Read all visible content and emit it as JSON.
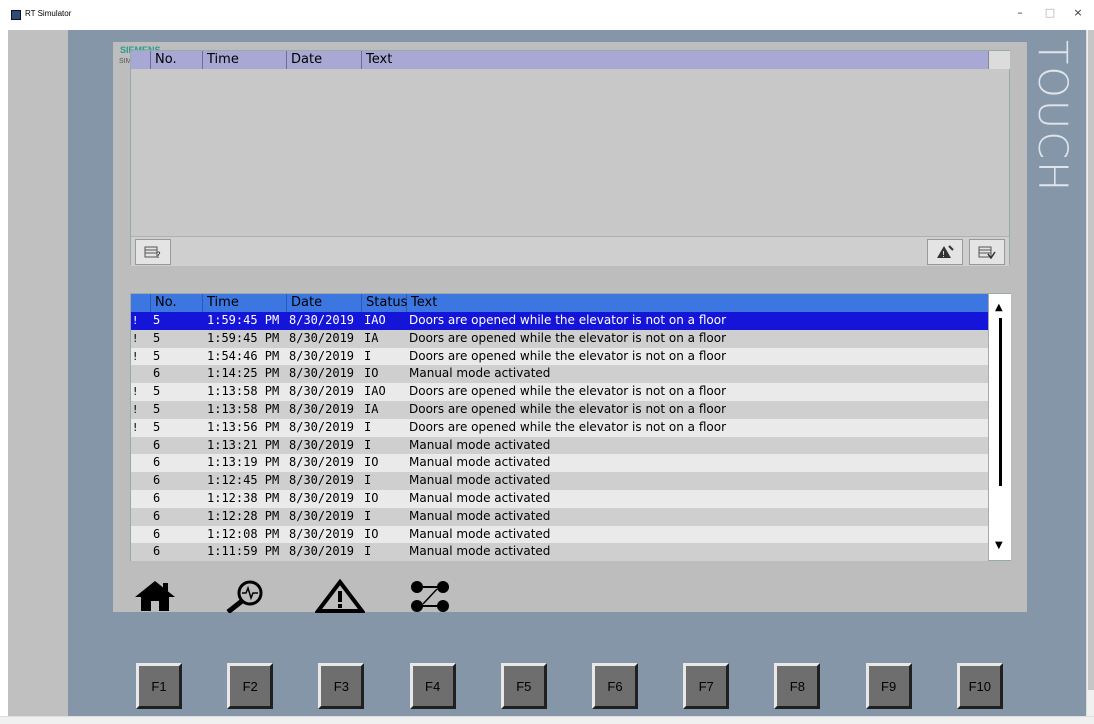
{
  "window": {
    "title": "RT Simulator",
    "minimize": "–",
    "maximize": "□",
    "close": "×"
  },
  "panel": {
    "brand_label": "TOUCH",
    "logo": "SIEMENS",
    "logo_sub": "SIMATIC"
  },
  "alarm_view_top": {
    "columns": [
      "No.",
      "Time",
      "Date",
      "Text"
    ],
    "rows": [],
    "buttons": {
      "info_icon": "info-text-icon",
      "ack_icon": "acknowledge-icon",
      "edit_icon": "edit-icon"
    }
  },
  "alarm_view_bottom": {
    "columns": [
      "No.",
      "Time",
      "Date",
      "Status",
      "Text"
    ],
    "rows": [
      {
        "flag": "!",
        "no": "5",
        "time": "1:59:45 PM",
        "date": "8/30/2019",
        "status": "IAO",
        "text": "Doors are opened while the elevator is not on a floor",
        "selected": true
      },
      {
        "flag": "!",
        "no": "5",
        "time": "1:59:45 PM",
        "date": "8/30/2019",
        "status": "IA",
        "text": "Doors are opened while the elevator is not on a floor"
      },
      {
        "flag": "!",
        "no": "5",
        "time": "1:54:46 PM",
        "date": "8/30/2019",
        "status": "I",
        "text": "Doors are opened while the elevator is not on a floor"
      },
      {
        "flag": "",
        "no": "6",
        "time": "1:14:25 PM",
        "date": "8/30/2019",
        "status": "IO",
        "text": "Manual mode activated"
      },
      {
        "flag": "!",
        "no": "5",
        "time": "1:13:58 PM",
        "date": "8/30/2019",
        "status": "IAO",
        "text": "Doors are opened while the elevator is not on a floor"
      },
      {
        "flag": "!",
        "no": "5",
        "time": "1:13:58 PM",
        "date": "8/30/2019",
        "status": "IA",
        "text": "Doors are opened while the elevator is not on a floor"
      },
      {
        "flag": "!",
        "no": "5",
        "time": "1:13:56 PM",
        "date": "8/30/2019",
        "status": "I",
        "text": "Doors are opened while the elevator is not on a floor"
      },
      {
        "flag": "",
        "no": "6",
        "time": "1:13:21 PM",
        "date": "8/30/2019",
        "status": "I",
        "text": "Manual mode activated"
      },
      {
        "flag": "",
        "no": "6",
        "time": "1:13:19 PM",
        "date": "8/30/2019",
        "status": "IO",
        "text": "Manual mode activated"
      },
      {
        "flag": "",
        "no": "6",
        "time": "1:12:45 PM",
        "date": "8/30/2019",
        "status": "I",
        "text": "Manual mode activated"
      },
      {
        "flag": "",
        "no": "6",
        "time": "1:12:38 PM",
        "date": "8/30/2019",
        "status": "IO",
        "text": "Manual mode activated"
      },
      {
        "flag": "",
        "no": "6",
        "time": "1:12:28 PM",
        "date": "8/30/2019",
        "status": "I",
        "text": "Manual mode activated"
      },
      {
        "flag": "",
        "no": "6",
        "time": "1:12:08 PM",
        "date": "8/30/2019",
        "status": "IO",
        "text": "Manual mode activated"
      },
      {
        "flag": "",
        "no": "6",
        "time": "1:11:59 PM",
        "date": "8/30/2019",
        "status": "I",
        "text": "Manual mode activated"
      }
    ]
  },
  "nav_icons": [
    "home-icon",
    "diagnostics-icon",
    "alarm-warning-icon",
    "network-icon"
  ],
  "function_keys": [
    "F1",
    "F2",
    "F3",
    "F4",
    "F5",
    "F6",
    "F7",
    "F8",
    "F9",
    "F10"
  ],
  "colors": {
    "header_blue": "#3c76e0",
    "selected_row": "#1515d9",
    "top_header": "#a8a8d4",
    "panel_dark": "#8496a8"
  }
}
